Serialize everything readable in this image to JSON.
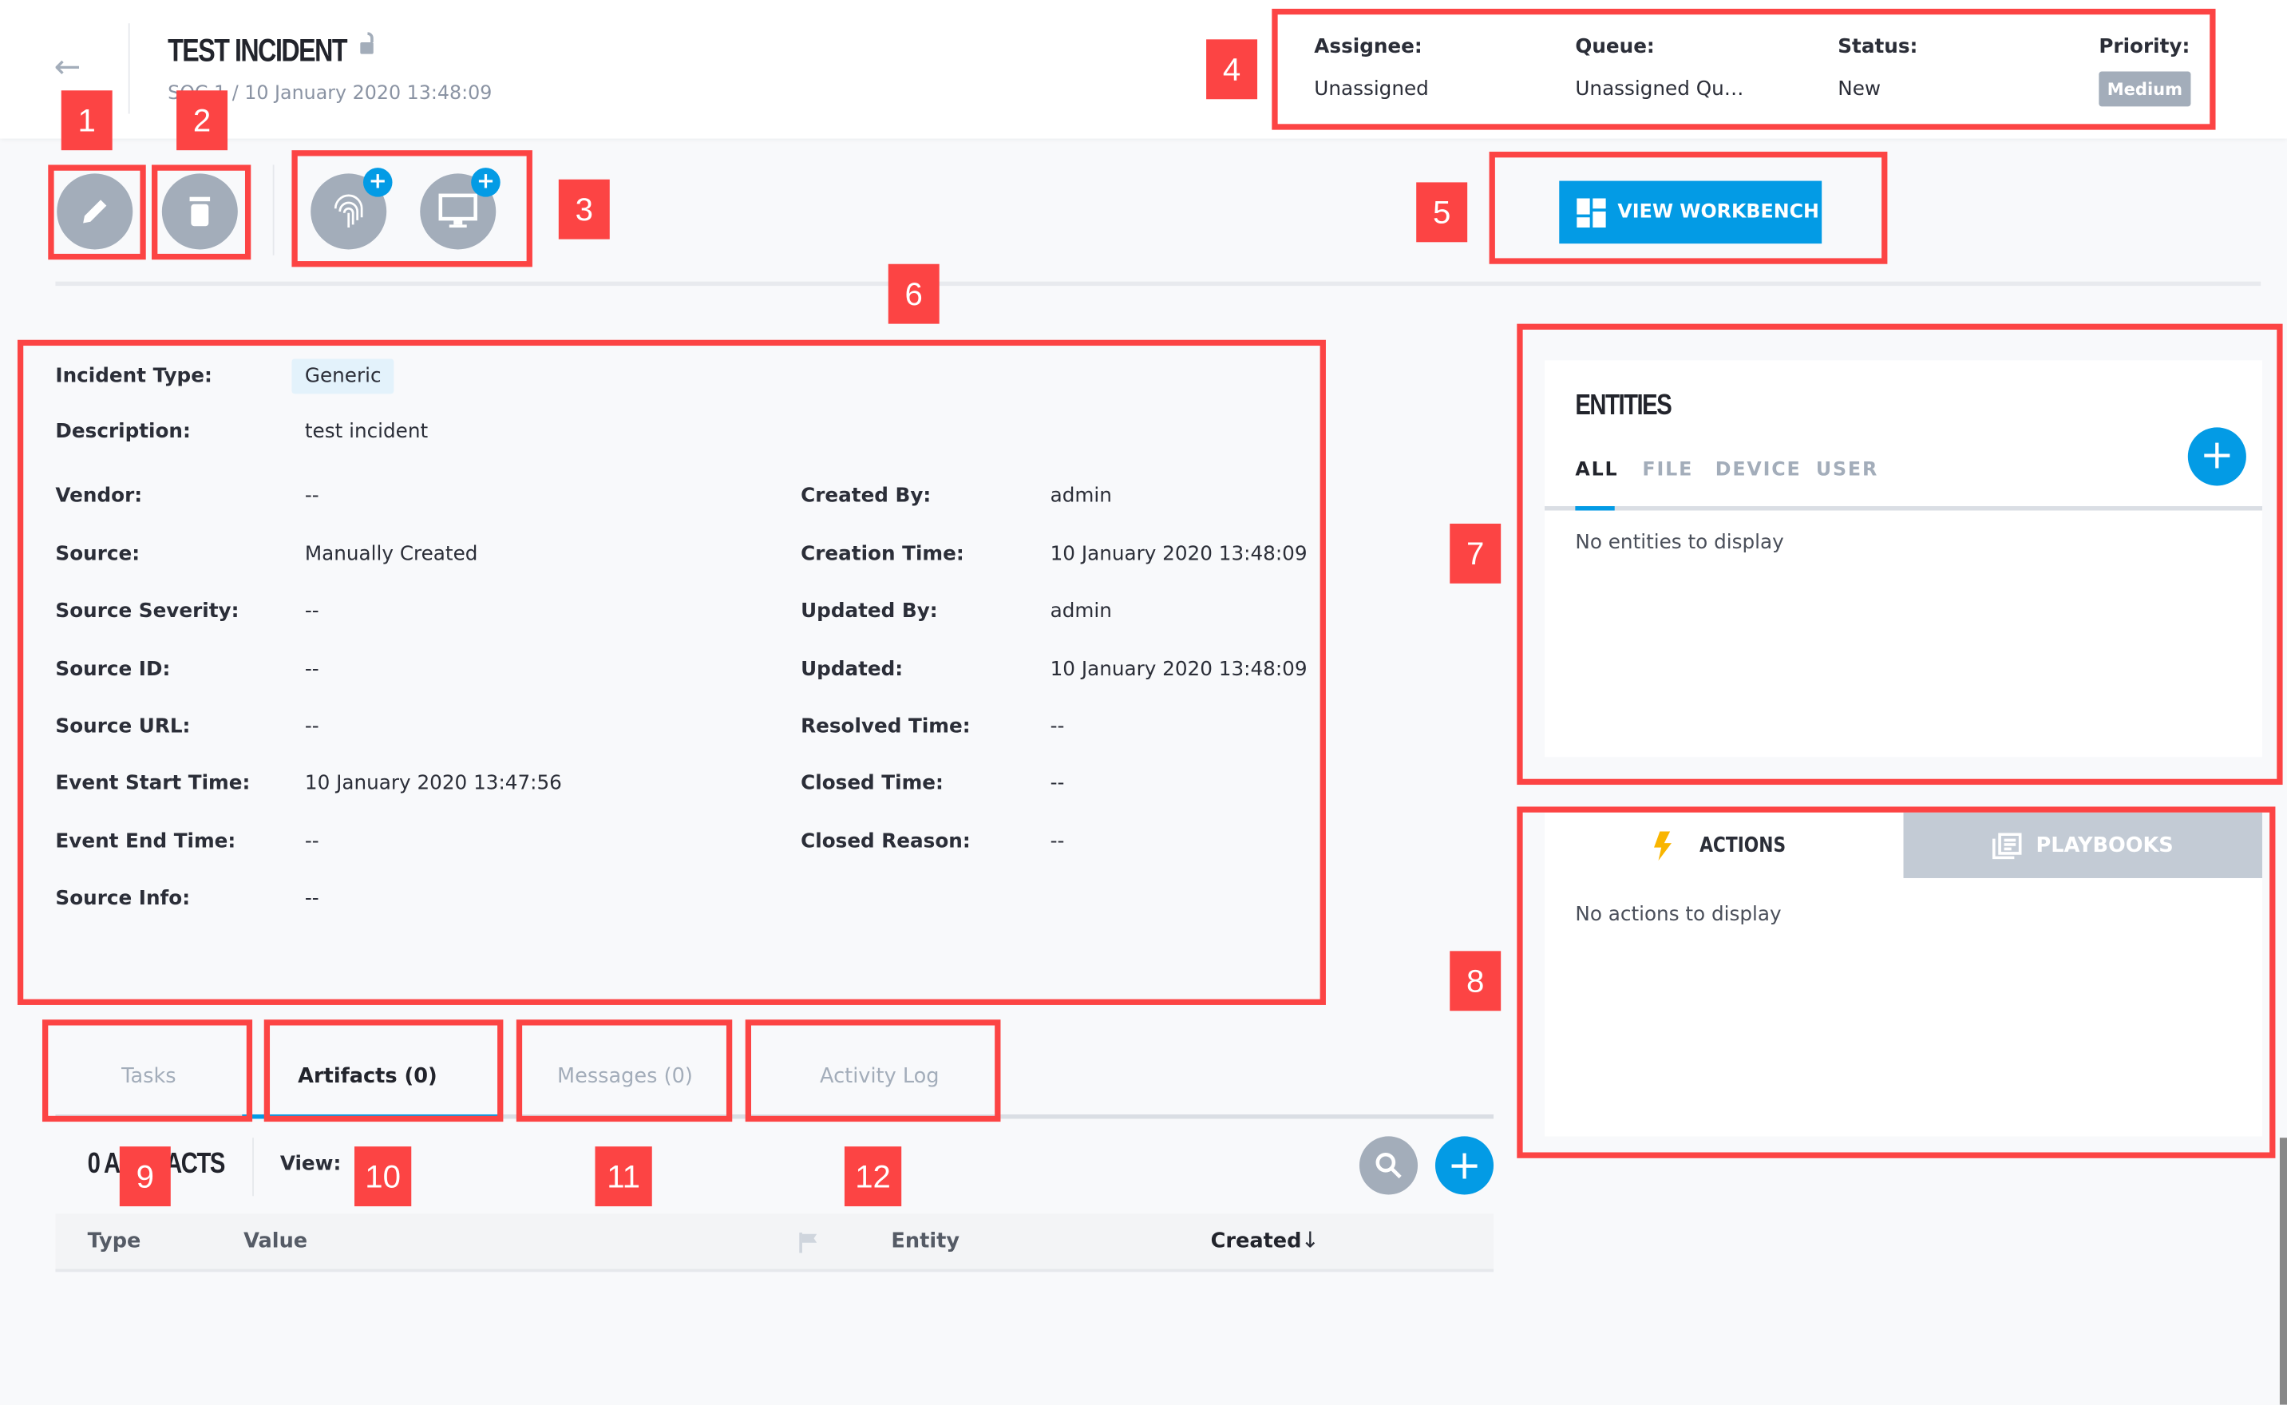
{
  "header": {
    "title": "TEST INCIDENT",
    "subtitle": "SOC 1 / 10 January 2020 13:48:09",
    "assignee_label": "Assignee:",
    "assignee": "Unassigned",
    "queue_label": "Queue:",
    "queue": "Unassigned Qu…",
    "status_label": "Status:",
    "status": "New",
    "priority_label": "Priority:",
    "priority": "Medium"
  },
  "toolbar": {
    "workbench_label": "VIEW WORKBENCH"
  },
  "details": {
    "left": [
      {
        "label": "Incident Type:",
        "value": "Generic"
      },
      {
        "label": "Description:",
        "value": "test incident"
      },
      {
        "label": "Vendor:",
        "value": "--"
      },
      {
        "label": "Source:",
        "value": "Manually Created"
      },
      {
        "label": "Source Severity:",
        "value": "--"
      },
      {
        "label": "Source ID:",
        "value": "--"
      },
      {
        "label": "Source URL:",
        "value": "--"
      },
      {
        "label": "Event Start Time:",
        "value": "10 January 2020 13:47:56"
      },
      {
        "label": "Event End Time:",
        "value": "--"
      },
      {
        "label": "Source Info:",
        "value": "--"
      }
    ],
    "right": [
      {
        "label": "Created By:",
        "value": "admin"
      },
      {
        "label": "Creation Time:",
        "value": "10 January 2020 13:48:09"
      },
      {
        "label": "Updated By:",
        "value": "admin"
      },
      {
        "label": "Updated:",
        "value": "10 January 2020 13:48:09"
      },
      {
        "label": "Resolved Time:",
        "value": "--"
      },
      {
        "label": "Closed Time:",
        "value": "--"
      },
      {
        "label": "Closed Reason:",
        "value": "--"
      }
    ]
  },
  "tabs": [
    "Tasks",
    "Artifacts (0)",
    "Messages (0)",
    "Activity Log"
  ],
  "artifacts": {
    "count_title": "0 ARTIFACTS",
    "view_label": "View:",
    "columns": [
      "Type",
      "Value",
      "Entity",
      "Created"
    ]
  },
  "entities": {
    "title": "ENTITIES",
    "tabs": [
      "ALL",
      "FILE",
      "DEVICE",
      "USER"
    ],
    "empty": "No entities to display"
  },
  "actions": {
    "tab_actions": "ACTIONS",
    "tab_playbooks": "PLAYBOOKS",
    "empty": "No actions to display"
  },
  "annotations": [
    "1",
    "2",
    "3",
    "4",
    "5",
    "6",
    "7",
    "8",
    "9",
    "10",
    "11",
    "12"
  ],
  "colors": {
    "accent": "#039be5",
    "annotation": "#fc4444",
    "icon_gray": "#a3adba"
  }
}
